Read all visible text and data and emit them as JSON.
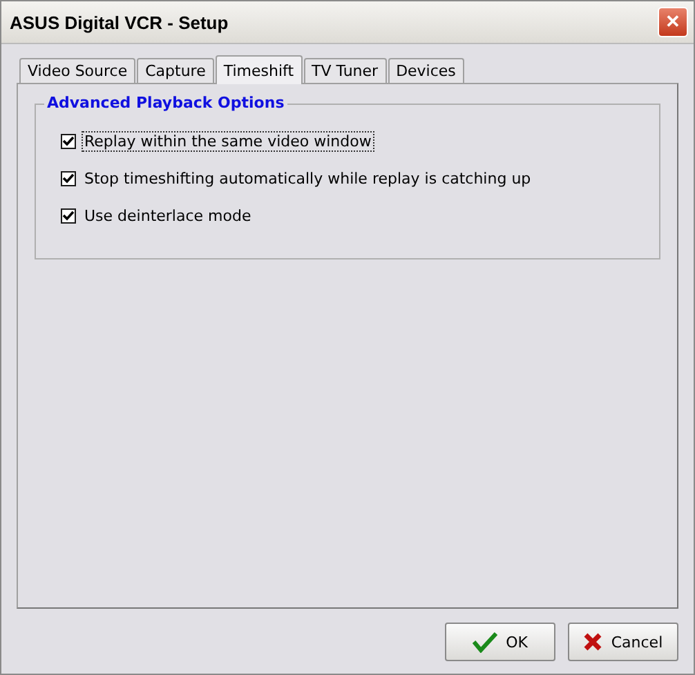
{
  "window": {
    "title": "ASUS Digital VCR - Setup",
    "close": "✕"
  },
  "tabs": [
    {
      "label": "Video Source",
      "selected": false
    },
    {
      "label": "Capture",
      "selected": false
    },
    {
      "label": "Timeshift",
      "selected": true
    },
    {
      "label": "TV Tuner",
      "selected": false
    },
    {
      "label": "Devices",
      "selected": false
    }
  ],
  "group": {
    "title": "Advanced Playback Options",
    "options": [
      {
        "label": "Replay within the same video window",
        "checked": true,
        "focused": true
      },
      {
        "label": "Stop timeshifting automatically while replay is catching up",
        "checked": true,
        "focused": false
      },
      {
        "label": "Use deinterlace mode",
        "checked": true,
        "focused": false
      }
    ]
  },
  "buttons": [
    {
      "label": "OK",
      "kind": "ok"
    },
    {
      "label": "Cancel",
      "kind": "cancel"
    }
  ]
}
